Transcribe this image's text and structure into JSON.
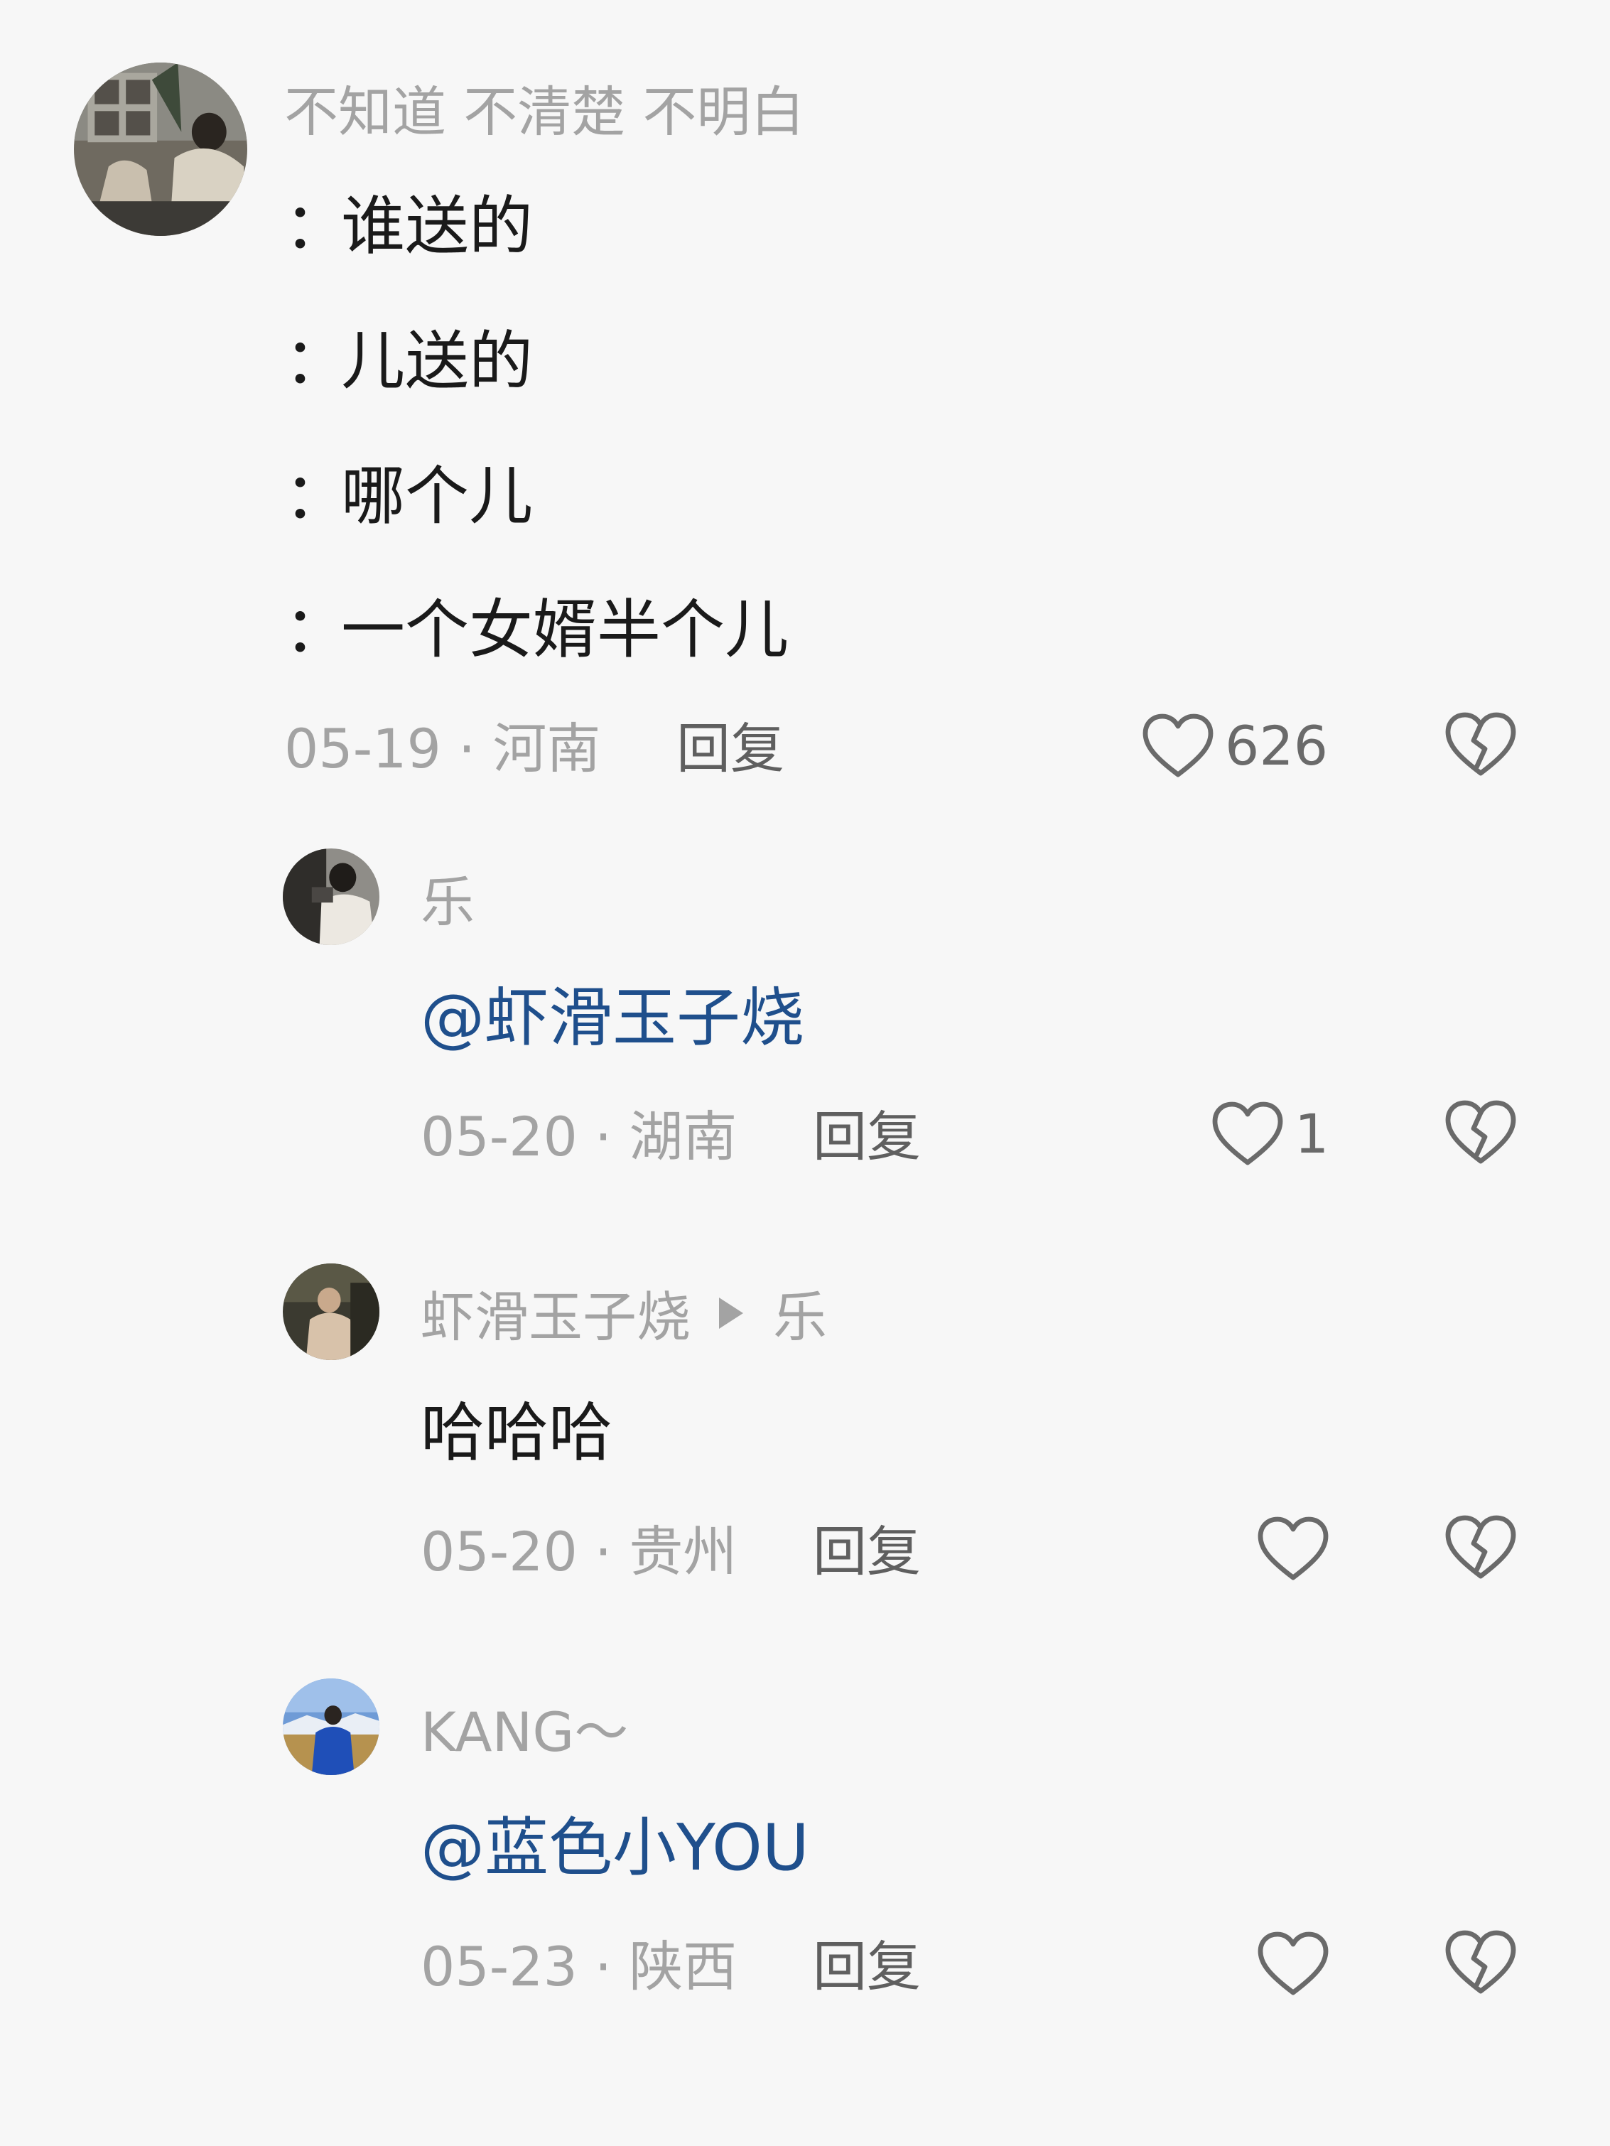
{
  "main_comment": {
    "avatar": "avatar-photo",
    "username": "不知道 不清楚  不明白",
    "lines": [
      {
        "colon": "：",
        "text": "谁送的"
      },
      {
        "colon": "：",
        "text": "儿送的"
      },
      {
        "colon": "：",
        "text": "哪个儿"
      },
      {
        "colon": "：",
        "text": "一个女婿半个儿"
      }
    ],
    "date_location": "05-19 · 河南",
    "reply_label": "回复",
    "like_count": "626"
  },
  "replies": [
    {
      "avatar": "avatar-photo",
      "username": "乐",
      "content": "@虾滑玉子烧",
      "content_type": "mention",
      "date_location": "05-20 · 湖南",
      "reply_label": "回复",
      "like_count": "1"
    },
    {
      "avatar": "avatar-photo",
      "username": "虾滑玉子烧",
      "reply_to": "乐",
      "content": "哈哈哈",
      "content_type": "text",
      "date_location": "05-20 · 贵州",
      "reply_label": "回复",
      "like_count": ""
    },
    {
      "avatar": "avatar-photo",
      "username": "KANG～",
      "content": "@蓝色小YOU",
      "content_type": "mention",
      "date_location": "05-23 · 陕西",
      "reply_label": "回复",
      "like_count": ""
    }
  ],
  "icons": {
    "like": "heart-outline-icon",
    "dislike": "broken-heart-icon",
    "reply_arrow": "play-arrow-icon"
  },
  "colors": {
    "background": "#f7f7f7",
    "username": "#a3a3a3",
    "body_text": "#1a1a1a",
    "mention": "#1f4f8c",
    "reply_button": "#5f5f5f",
    "icon_stroke": "#6a6a6a"
  }
}
